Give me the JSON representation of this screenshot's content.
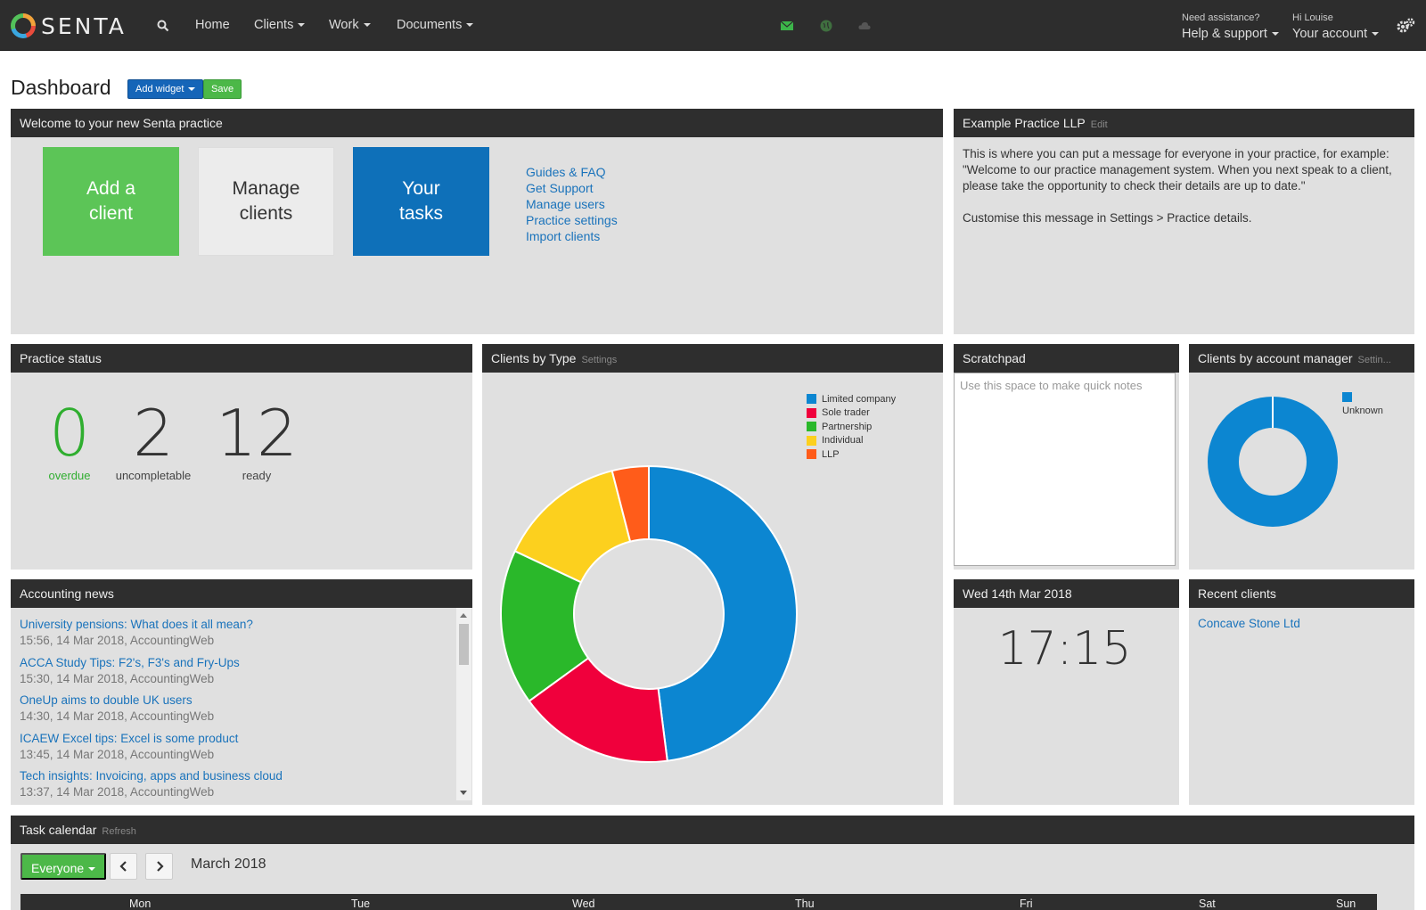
{
  "brand": {
    "name": "SENTA"
  },
  "nav": {
    "items": [
      "Home",
      "Clients",
      "Work",
      "Documents"
    ],
    "help_small": "Need assistance?",
    "help_big": "Help & support",
    "account_small": "Hi Louise",
    "account_big": "Your account",
    "status_icons": [
      "envelope-icon",
      "globe-icon",
      "cloud-icon"
    ]
  },
  "dashboard": {
    "title": "Dashboard",
    "add_widget": "Add widget",
    "save": "Save"
  },
  "welcome": {
    "title": "Welcome to your new Senta practice",
    "tiles": [
      {
        "line1": "Add a",
        "line2": "client"
      },
      {
        "line1": "Manage",
        "line2": "clients"
      },
      {
        "line1": "Your",
        "line2": "tasks"
      }
    ],
    "links": [
      "Guides & FAQ",
      "Get Support",
      "Manage users",
      "Practice settings",
      "Import clients"
    ]
  },
  "practice_msg": {
    "title": "Example Practice LLP",
    "edit": "Edit",
    "line1": "This is where you can put a message for everyone in your practice, for example:",
    "line2": "\"Welcome to our practice management system.  When you next speak to a client,",
    "line3": "please take the opportunity to check their details are up to date.\"",
    "line4": "Customise this message in Settings > Practice details."
  },
  "practice_status": {
    "title": "Practice status",
    "stats": [
      {
        "value": "0",
        "label": "overdue"
      },
      {
        "value": "2",
        "label": "uncompletable"
      },
      {
        "value": "12",
        "label": "ready"
      }
    ]
  },
  "clients_by_type": {
    "title": "Clients by Type",
    "settings": "Settings"
  },
  "scratchpad": {
    "title": "Scratchpad",
    "placeholder": "Use this space to make quick notes"
  },
  "account_manager": {
    "title": "Clients by account manager",
    "settings": "Settin..."
  },
  "news": {
    "title": "Accounting news",
    "items": [
      {
        "headline": "University pensions: What does it all mean?",
        "meta": "15:56, 14 Mar 2018, AccountingWeb"
      },
      {
        "headline": "ACCA Study Tips: F2's, F3's and Fry-Ups",
        "meta": "15:30, 14 Mar 2018, AccountingWeb"
      },
      {
        "headline": "OneUp aims to double UK users",
        "meta": "14:30, 14 Mar 2018, AccountingWeb"
      },
      {
        "headline": "ICAEW Excel tips: Excel is some product",
        "meta": "13:45, 14 Mar 2018, AccountingWeb"
      },
      {
        "headline": "Tech insights: Invoicing, apps and business cloud",
        "meta": "13:37, 14 Mar 2018, AccountingWeb"
      }
    ]
  },
  "date_widget": {
    "title": "Wed 14th Mar 2018",
    "time": "17:15"
  },
  "recent": {
    "title": "Recent clients",
    "items": [
      "Concave Stone Ltd"
    ]
  },
  "calendar": {
    "title": "Task calendar",
    "refresh": "Refresh",
    "filter": "Everyone",
    "month": "March 2018",
    "days": [
      "Mon",
      "Tue",
      "Wed",
      "Thu",
      "Fri",
      "Sat",
      "Sun"
    ]
  },
  "colors": {
    "limited": "#0c86d1",
    "sole": "#f0003c",
    "partnership": "#2ab82a",
    "individual": "#fcd01e",
    "llp": "#ff5c1a"
  },
  "chart_data": [
    {
      "type": "pie",
      "title": "Clients by Type",
      "categories": [
        "Limited company",
        "Sole trader",
        "Partnership",
        "Individual",
        "LLP"
      ],
      "values": [
        48,
        17,
        17,
        14,
        4
      ],
      "colors": [
        "#0c86d1",
        "#f0003c",
        "#2ab82a",
        "#fcd01e",
        "#ff5c1a"
      ],
      "legend": "top-right",
      "donut": true
    },
    {
      "type": "pie",
      "title": "Clients by account manager",
      "categories": [
        "Unknown"
      ],
      "values": [
        100
      ],
      "colors": [
        "#0c86d1"
      ],
      "legend": "top-right",
      "donut": true
    }
  ]
}
